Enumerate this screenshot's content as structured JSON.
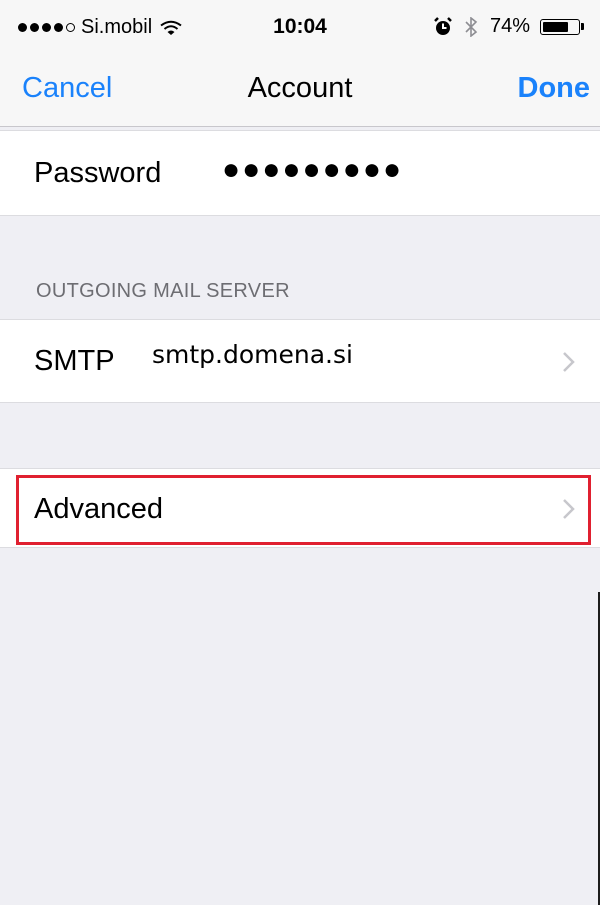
{
  "status_bar": {
    "carrier": "Si.mobil",
    "time": "10:04",
    "battery_percent": "74%",
    "battery_level": 0.74,
    "signal_bars_filled": 4,
    "signal_bars_total": 5
  },
  "nav": {
    "cancel": "Cancel",
    "title": "Account",
    "done": "Done"
  },
  "password": {
    "label": "Password",
    "value": "●●●●●●●●●"
  },
  "outgoing": {
    "header": "OUTGOING MAIL SERVER",
    "smtp_label": "SMTP",
    "smtp_value": "smtp.domena.si"
  },
  "advanced": {
    "label": "Advanced"
  },
  "colors": {
    "tint": "#1a82fb",
    "background": "#efeff4",
    "highlight": "#e02030"
  },
  "icons": [
    "wifi-icon",
    "alarm-icon",
    "bluetooth-icon",
    "battery-icon",
    "chevron-right-icon"
  ]
}
